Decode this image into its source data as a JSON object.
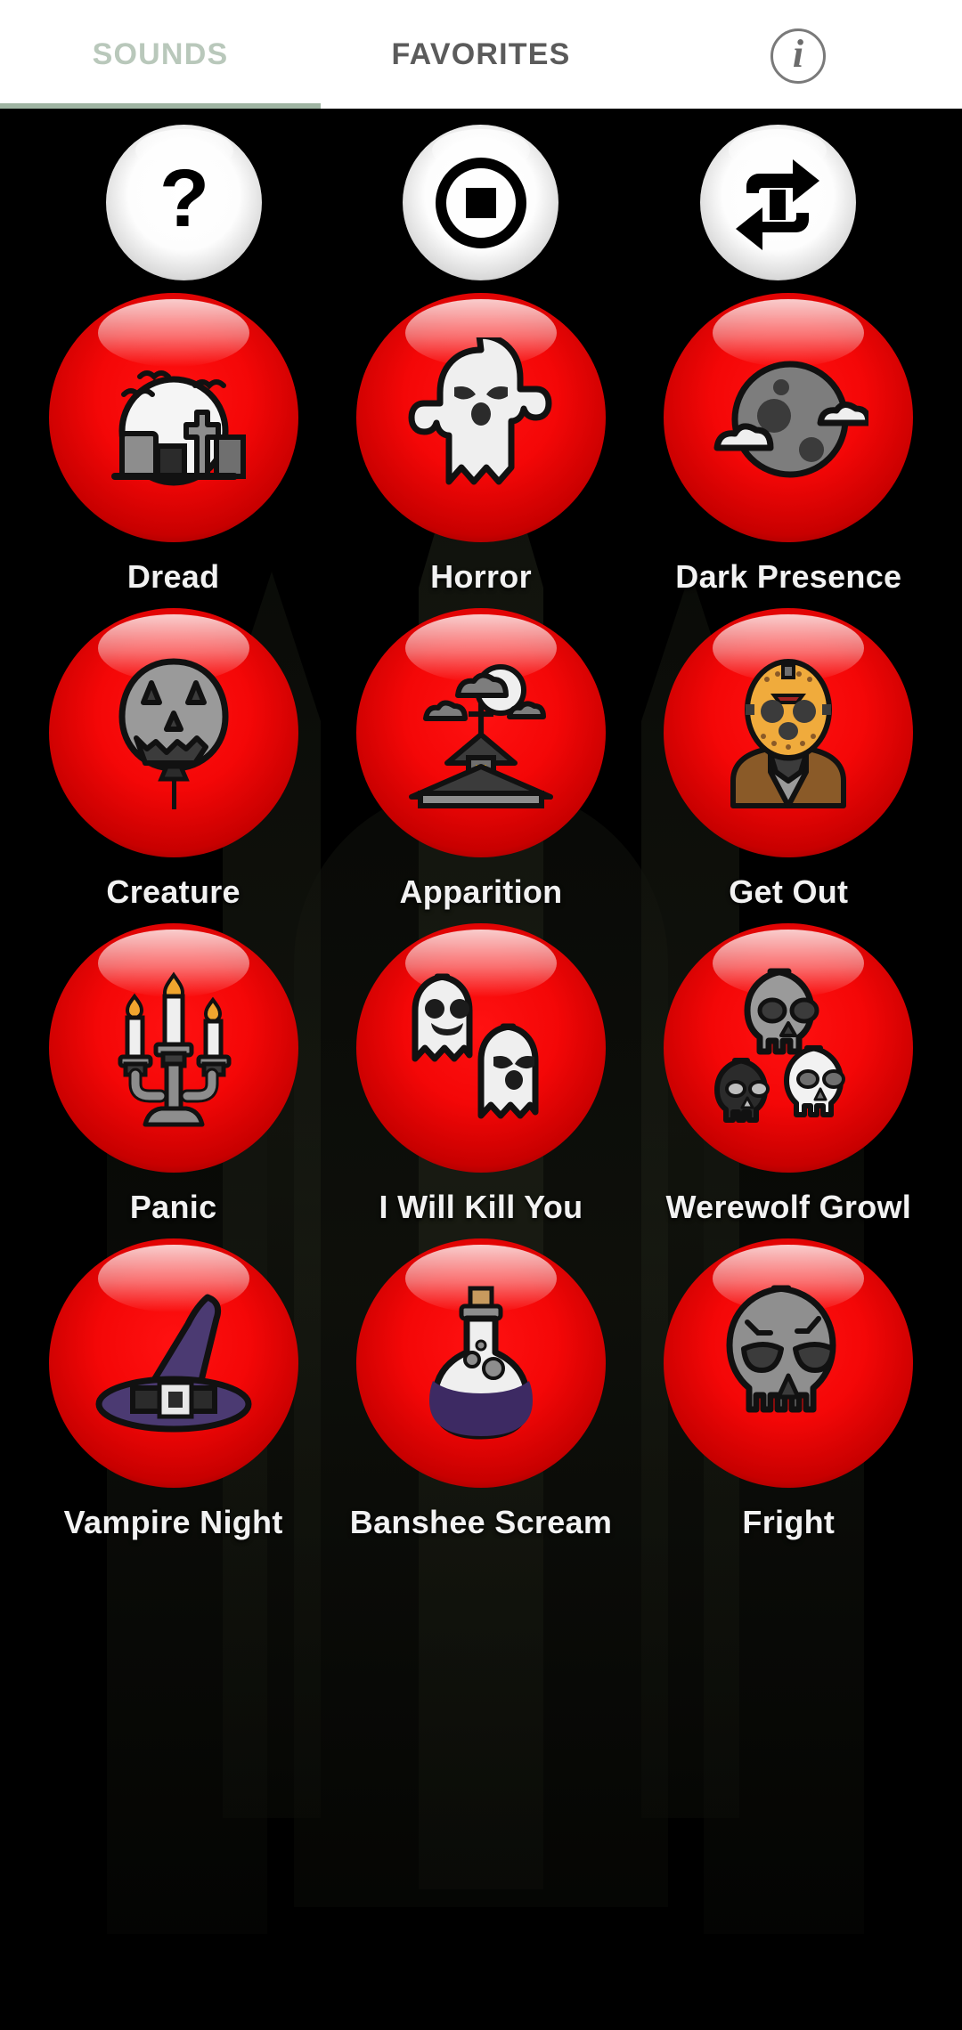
{
  "tabs": {
    "sounds": "SOUNDS",
    "favorites": "FAVORITES",
    "info_icon": "info-icon"
  },
  "controls": [
    {
      "name": "help-button",
      "icon": "question-mark-icon"
    },
    {
      "name": "stop-button",
      "icon": "stop-icon"
    },
    {
      "name": "loop-button",
      "icon": "repeat-icon"
    }
  ],
  "sounds": [
    {
      "label": "Dread",
      "icon": "cemetery-icon"
    },
    {
      "label": "Horror",
      "icon": "ghost-icon"
    },
    {
      "label": "Dark Presence",
      "icon": "moon-clouds-icon"
    },
    {
      "label": "Creature",
      "icon": "jack-o-lantern-balloon-icon"
    },
    {
      "label": "Apparition",
      "icon": "haunted-church-icon"
    },
    {
      "label": "Get Out",
      "icon": "hockey-mask-killer-icon"
    },
    {
      "label": "Panic",
      "icon": "candelabra-icon"
    },
    {
      "label": "I Will Kill You",
      "icon": "two-ghosts-icon"
    },
    {
      "label": "Werewolf Growl",
      "icon": "three-skulls-icon"
    },
    {
      "label": "Vampire Night",
      "icon": "witch-hat-icon"
    },
    {
      "label": "Banshee Scream",
      "icon": "potion-flask-icon"
    },
    {
      "label": "Fright",
      "icon": "skull-icon"
    }
  ],
  "colors": {
    "orb_red": "#f40707",
    "orb_white": "#ffffff",
    "tab_active": "#b9c8bb",
    "tab_inactive": "#5b5b5b",
    "background": "#000000",
    "label_text": "#f2f2f2"
  }
}
